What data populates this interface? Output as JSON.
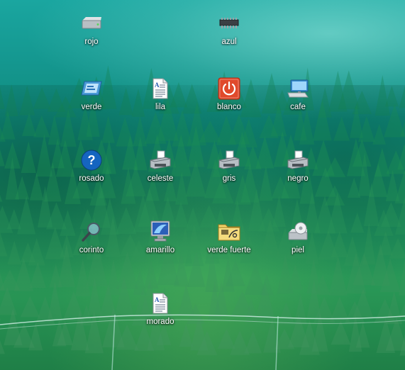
{
  "desktop": {
    "icons": [
      {
        "label": "rojo",
        "icon": "drive-icon"
      },
      {
        "label": "azul",
        "icon": "chip-icon"
      },
      {
        "label": "verde",
        "icon": "screen-icon"
      },
      {
        "label": "lila",
        "icon": "document-icon"
      },
      {
        "label": "blanco",
        "icon": "power-icon"
      },
      {
        "label": "cafe",
        "icon": "computer-icon"
      },
      {
        "label": "rosado",
        "icon": "help-icon"
      },
      {
        "label": "celeste",
        "icon": "printer-icon"
      },
      {
        "label": "gris",
        "icon": "printer-icon"
      },
      {
        "label": "negro",
        "icon": "printer-icon"
      },
      {
        "label": "corinto",
        "icon": "search-icon"
      },
      {
        "label": "amarillo",
        "icon": "monitor-icon"
      },
      {
        "label": "verde fuerte",
        "icon": "folder-icon"
      },
      {
        "label": "piel",
        "icon": "disc-drive-icon"
      },
      {
        "label": "morado",
        "icon": "document-icon"
      }
    ]
  },
  "colors": {
    "sky": "#1aa6a0",
    "forest": "#1f7f47",
    "power_button": "#e0492b",
    "help_button": "#1565c0",
    "folder": "#f2d36b"
  }
}
